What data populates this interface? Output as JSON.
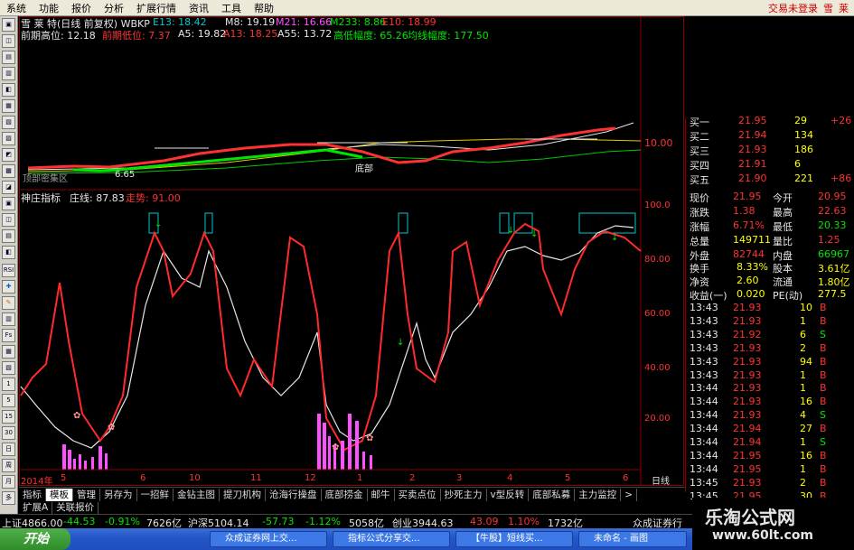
{
  "menu": {
    "items": [
      "系统",
      "功能",
      "报价",
      "分析",
      "扩展行情",
      "资讯",
      "工具",
      "帮助"
    ],
    "login": "交易未登录",
    "right_chars": [
      "雪",
      "莱"
    ]
  },
  "header": {
    "line1": {
      "name": "雪 莱 特(日线 前复权) WBKP",
      "e13": "E13: 18.42",
      "m8": "M8: 19.19",
      "m21": "M21: 16.66",
      "m233": "M233: 8.86",
      "e10": "E10: 18.99"
    },
    "line2": {
      "prev_high": "前期高位: 12.18",
      "prev_low": "前期低位: 7.37",
      "a5": "A5: 19.82",
      "a13": "A13: 18.25",
      "a55": "A55: 13.72",
      "highlow": "高低幅度: 65.26",
      "avg": "均线幅度: 177.50"
    }
  },
  "main_chart": {
    "price_axis": [
      "10.00"
    ],
    "annotations": [
      "6.65",
      "底部",
      "顶部密集区"
    ]
  },
  "indicator": {
    "title": "神庄指标",
    "zhuangxian": "庄线: 87.83",
    "zouxiang": "走势: 91.00",
    "axis": [
      "100.0",
      "80.00",
      "60.00",
      "40.00",
      "20.00"
    ]
  },
  "time_axis": {
    "labels": [
      "2014年",
      "5",
      "6",
      "10",
      "11",
      "12",
      "1",
      "2",
      "3",
      "4",
      "5",
      "6"
    ],
    "period": "日线"
  },
  "order_book": [
    {
      "label": "买一",
      "price": "21.95",
      "vol": "29",
      "chg": "+26"
    },
    {
      "label": "买二",
      "price": "21.94",
      "vol": "134",
      "chg": ""
    },
    {
      "label": "买三",
      "price": "21.93",
      "vol": "186",
      "chg": ""
    },
    {
      "label": "买四",
      "price": "21.91",
      "vol": "6",
      "chg": ""
    },
    {
      "label": "买五",
      "price": "21.90",
      "vol": "221",
      "chg": "+86"
    }
  ],
  "quote": {
    "rows": [
      {
        "l1": "现价",
        "v1": "21.95",
        "l2": "今开",
        "v2": "20.95"
      },
      {
        "l1": "涨跌",
        "v1": "1.38",
        "l2": "最高",
        "v2": "22.63"
      },
      {
        "l1": "涨幅",
        "v1": "6.71%",
        "l2": "最低",
        "v2": "20.33"
      },
      {
        "l1": "总量",
        "v1": "149711",
        "l2": "量比",
        "v2": "1.25"
      },
      {
        "l1": "外盘",
        "v1": "82744",
        "l2": "内盘",
        "v2": "66967"
      }
    ],
    "rows2": [
      {
        "l1": "换手",
        "v1": "8.33%",
        "l2": "股本",
        "v2": "3.61亿"
      },
      {
        "l1": "净资",
        "v1": "2.60",
        "l2": "流通",
        "v2": "1.80亿"
      },
      {
        "l1": "收益(一)",
        "v1": "0.020",
        "l2": "PE(动)",
        "v2": "277.5"
      }
    ]
  },
  "ticks": [
    {
      "time": "13:43",
      "price": "21.93",
      "vol": "10",
      "bs": "B"
    },
    {
      "time": "13:43",
      "price": "21.93",
      "vol": "1",
      "bs": "B"
    },
    {
      "time": "13:43",
      "price": "21.92",
      "vol": "6",
      "bs": "S"
    },
    {
      "time": "13:43",
      "price": "21.93",
      "vol": "2",
      "bs": "B"
    },
    {
      "time": "13:43",
      "price": "21.93",
      "vol": "94",
      "bs": "B"
    },
    {
      "time": "13:43",
      "price": "21.93",
      "vol": "1",
      "bs": "B"
    },
    {
      "time": "13:44",
      "price": "21.93",
      "vol": "1",
      "bs": "B"
    },
    {
      "time": "13:44",
      "price": "21.93",
      "vol": "16",
      "bs": "B"
    },
    {
      "time": "13:44",
      "price": "21.93",
      "vol": "4",
      "bs": "S"
    },
    {
      "time": "13:44",
      "price": "21.94",
      "vol": "27",
      "bs": "B"
    },
    {
      "time": "13:44",
      "price": "21.94",
      "vol": "1",
      "bs": "S"
    },
    {
      "time": "13:44",
      "price": "21.95",
      "vol": "16",
      "bs": "B"
    },
    {
      "time": "13:44",
      "price": "21.95",
      "vol": "1",
      "bs": "B"
    },
    {
      "time": "13:45",
      "price": "21.93",
      "vol": "2",
      "bs": "B"
    },
    {
      "time": "13:45",
      "price": "21.95",
      "vol": "30",
      "bs": "B"
    }
  ],
  "tabs": [
    "指标",
    "模板",
    "管理",
    "另存为",
    "一招鲜",
    "金钻主图",
    "提刀机构",
    "沧海行操盘",
    "底部捞金",
    "邮牛",
    "买卖点位",
    "抄死主力",
    "v型反转",
    "底部私募",
    "主力监控",
    ">"
  ],
  "tabs2": [
    "扩展A",
    "关联报价"
  ],
  "ticker": {
    "sh": "上证4866.00",
    "sh_chg": "-44.53",
    "sh_pct": "-0.91%",
    "sh_amt": "7626亿",
    "hs": "沪深5104.14",
    "hs_chg": "-57.73",
    "hs_pct": "-1.12%",
    "hs_amt": "5058亿",
    "cy": "创业3944.63",
    "cy_chg": "43.09",
    "cy_pct": "1.10%",
    "cy_amt": "1732亿",
    "broker": "众成证券行"
  },
  "taskbar": {
    "start": "开始",
    "tasks": [
      "众成证券网上交...",
      "指标公式分享交...",
      "【牛股】短线买...",
      "未命名 - 画图"
    ]
  },
  "watermark": {
    "line1": "乐淘公式网",
    "line2": "www.60lt.com"
  },
  "left_toolbar": [
    "周",
    "月",
    "多",
    "日",
    "30",
    "15",
    "5",
    "1",
    "RSI"
  ],
  "colors": {
    "up": "#ff3232",
    "down": "#00e600",
    "neutral": "#e6e6e6",
    "white_line": "#e6e6e6",
    "volume": "#ff50ff"
  }
}
